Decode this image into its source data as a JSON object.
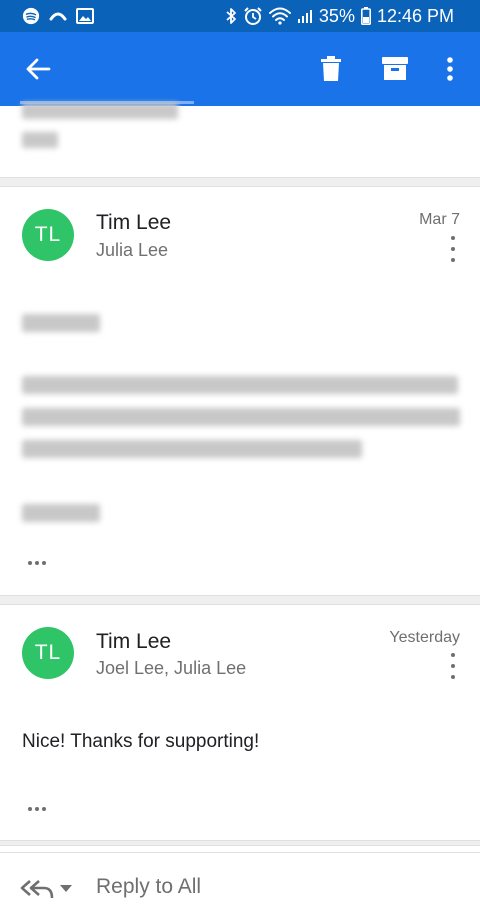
{
  "status_bar": {
    "battery_percent": "35%",
    "time": "12:46 PM",
    "icons": [
      "spotify-icon",
      "hotspot-icon",
      "gallery-icon",
      "bluetooth-icon",
      "alarm-icon",
      "wifi-icon",
      "signal-icon",
      "battery-icon"
    ]
  },
  "app_bar": {
    "icons": [
      "back-arrow-icon",
      "trash-icon",
      "archive-icon",
      "more-vert-icon"
    ],
    "color": "#1a73e8"
  },
  "messages": [
    {
      "avatar_initials": "TL",
      "sender": "Tim Lee",
      "recipients": "Julia Lee",
      "date": "Mar 7",
      "body": ""
    },
    {
      "avatar_initials": "TL",
      "sender": "Tim Lee",
      "recipients": "Joel Lee, Julia Lee",
      "date": "Yesterday",
      "body": "Nice! Thanks for supporting!"
    }
  ],
  "reply_bar": {
    "label": "Reply to All"
  },
  "colors": {
    "avatar": "#2fc468",
    "status_bar": "#0a63b8"
  }
}
